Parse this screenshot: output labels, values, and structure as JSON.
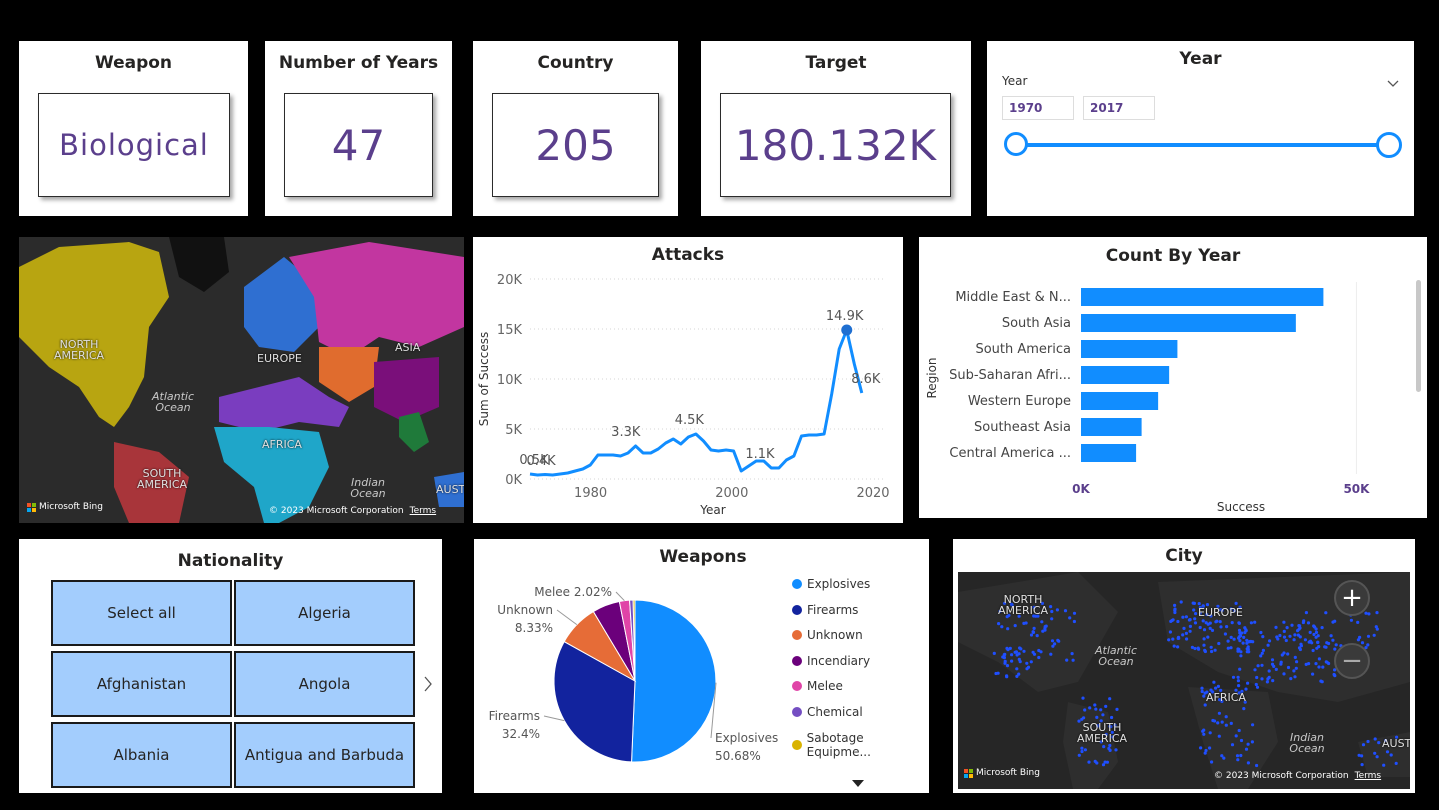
{
  "kpis": [
    {
      "title": "Weapon",
      "value": "Biological"
    },
    {
      "title": "Number of Years",
      "value": "47"
    },
    {
      "title": "Country",
      "value": "205"
    },
    {
      "title": "Target",
      "value": "180.132K"
    }
  ],
  "year_slicer": {
    "title": "Year",
    "field_label": "Year",
    "start": "1970",
    "end": "2017"
  },
  "region_map": {
    "labels": {
      "north_america": "NORTH AMERICA",
      "europe": "EUROPE",
      "asia": "ASIA",
      "africa": "AFRICA",
      "south_america": "SOUTH AMERICA",
      "atlantic": "Atlantic Ocean",
      "indian": "Indian Ocean",
      "aust": "AUST"
    },
    "attribution": "Microsoft Bing",
    "copyright": "© 2023 Microsoft Corporation",
    "terms": "Terms",
    "colors": {
      "north_america": "#b8a511",
      "europe": "#2f6fd1",
      "russia": "#c236a0",
      "middle_east": "#7a3dbf",
      "africa": "#1fa6c9",
      "south_america": "#a8353a",
      "china": "#7a0f7a",
      "south_asia": "#e06c2e"
    }
  },
  "attacks_chart": {
    "title": "Attacks",
    "chart_data": {
      "type": "line",
      "title": "Attacks",
      "xlabel": "Year",
      "ylabel": "Sum of Success",
      "xlim": [
        1970,
        2020
      ],
      "ylim": [
        0,
        20000
      ],
      "x_ticks": [
        "1980",
        "2000",
        "2020"
      ],
      "y_ticks": [
        "0K",
        "5K",
        "10K",
        "15K",
        "20K"
      ],
      "x": [
        1970,
        1971,
        1972,
        1973,
        1974,
        1975,
        1976,
        1977,
        1978,
        1979,
        1980,
        1981,
        1982,
        1983,
        1984,
        1985,
        1986,
        1987,
        1988,
        1989,
        1990,
        1991,
        1992,
        1993,
        1994,
        1995,
        1996,
        1997,
        1998,
        1999,
        2000,
        2001,
        2002,
        2003,
        2004,
        2005,
        2006,
        2007,
        2008,
        2009,
        2010,
        2011,
        2012,
        2013,
        2014,
        2015,
        2016,
        2017
      ],
      "y": [
        500,
        400,
        450,
        400,
        500,
        600,
        800,
        1000,
        1400,
        2400,
        2400,
        2400,
        2300,
        2600,
        3300,
        2600,
        2600,
        3000,
        3600,
        4000,
        3500,
        4200,
        4500,
        3800,
        2900,
        2800,
        2900,
        2800,
        800,
        1300,
        1800,
        1800,
        1100,
        1100,
        1900,
        2300,
        4300,
        4400,
        4400,
        4500,
        8500,
        13000,
        14900,
        11500,
        8600
      ],
      "data_labels": [
        {
          "x": 1970,
          "y": 500,
          "text": "0.5K"
        },
        {
          "x": 1971,
          "y": 400,
          "text": "0.4K"
        },
        {
          "x": 1983,
          "y": 3300,
          "text": "3.3K"
        },
        {
          "x": 1992,
          "y": 4500,
          "text": "4.5K"
        },
        {
          "x": 2002,
          "y": 1100,
          "text": "1.1K"
        },
        {
          "x": 2014,
          "y": 14900,
          "text": "14.9K"
        },
        {
          "x": 2017,
          "y": 8600,
          "text": "8.6K"
        }
      ],
      "color": "#118dff"
    }
  },
  "count_by_year": {
    "title": "Count By Year",
    "chart_data": {
      "type": "bar",
      "orientation": "horizontal",
      "title": "Count By Year",
      "xlabel": "Success",
      "ylabel": "Region",
      "xlim": [
        0,
        55000
      ],
      "x_ticks": [
        "0K",
        "50K"
      ],
      "categories": [
        "Middle East & N...",
        "South Asia",
        "South America",
        "Sub-Saharan Afri...",
        "Western Europe",
        "Southeast Asia",
        "Central America ..."
      ],
      "values": [
        44000,
        39000,
        17500,
        16000,
        14000,
        11000,
        10000
      ],
      "color": "#118dff"
    }
  },
  "nationality": {
    "title": "Nationality",
    "items": [
      "Select all",
      "Algeria",
      "Afghanistan",
      "Angola",
      "Albania",
      "Antigua and Barbuda"
    ]
  },
  "weapons_chart": {
    "title": "Weapons",
    "chart_data": {
      "type": "pie",
      "title": "Weapons",
      "categories": [
        "Explosives",
        "Firearms",
        "Unknown",
        "Incendiary",
        "Melee",
        "Chemical",
        "Sabotage Equipme..."
      ],
      "values": [
        50.68,
        32.4,
        8.33,
        5.5,
        2.02,
        0.7,
        0.37
      ],
      "colors": [
        "#118dff",
        "#12239e",
        "#e66c37",
        "#6b007b",
        "#e044a7",
        "#744ec2",
        "#d9b300"
      ],
      "data_labels": [
        {
          "category": "Explosives",
          "name": "Explosives",
          "pct": "50.68%"
        },
        {
          "category": "Firearms",
          "name": "Firearms",
          "pct": "32.4%"
        },
        {
          "category": "Unknown",
          "name": "Unknown",
          "pct": "8.33%"
        },
        {
          "category": "Melee",
          "name": "Melee 2.02%",
          "pct": ""
        }
      ]
    }
  },
  "city_map": {
    "title": "City",
    "labels": {
      "north_america": "NORTH AMERICA",
      "europe": "EUROPE",
      "africa": "AFRICA",
      "south_america": "SOUTH AMERICA",
      "atlantic": "Atlantic Ocean",
      "indian": "Indian Ocean",
      "aust": "AUST"
    },
    "attribution": "Microsoft Bing",
    "copyright": "© 2023 Microsoft Corporation",
    "terms": "Terms",
    "zoom_in": "+",
    "zoom_out": "−",
    "dot_color": "#1f4fff"
  }
}
